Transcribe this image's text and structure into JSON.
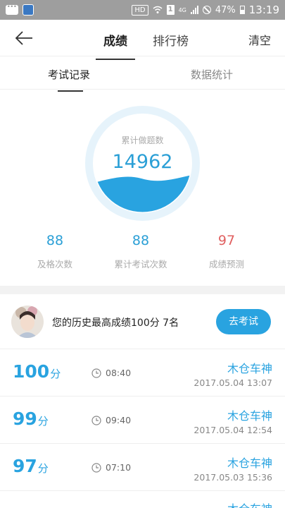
{
  "status_bar": {
    "hd": "HD",
    "sim": "1",
    "network": "4G",
    "battery": "47%",
    "time": "13:19"
  },
  "nav": {
    "tab_score": "成绩",
    "tab_rank": "排行榜",
    "clear": "清空"
  },
  "subtabs": {
    "records": "考试记录",
    "stats": "数据统计"
  },
  "gauge": {
    "label": "累计做题数",
    "value": "14962"
  },
  "stats": [
    {
      "value": "88",
      "label": "及格次数",
      "color": "#2a9fd6"
    },
    {
      "value": "88",
      "label": "累计考试次数",
      "color": "#2a9fd6"
    },
    {
      "value": "97",
      "label": "成绩预测",
      "color": "#e06060"
    }
  ],
  "best": {
    "text": "您的历史最高成绩100分 7名",
    "button": "去考试"
  },
  "records": [
    {
      "score": "100",
      "unit": "分",
      "duration": "08:40",
      "name": "木仓车神",
      "datetime": "2017.05.04 13:07"
    },
    {
      "score": "99",
      "unit": "分",
      "duration": "09:40",
      "name": "木仓车神",
      "datetime": "2017.05.04 12:54"
    },
    {
      "score": "97",
      "unit": "分",
      "duration": "07:10",
      "name": "木仓车神",
      "datetime": "2017.05.03 15:36"
    },
    {
      "name": "木仓车神"
    }
  ],
  "colors": {
    "accent": "#29a3e0",
    "prediction": "#e06060"
  }
}
